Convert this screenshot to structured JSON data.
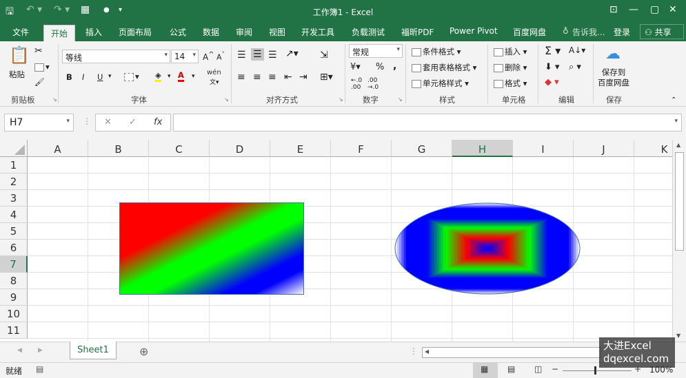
{
  "window": {
    "title": "工作簿1 - Excel"
  },
  "tabs": [
    "文件",
    "开始",
    "插入",
    "页面布局",
    "公式",
    "数据",
    "审阅",
    "视图",
    "开发工具",
    "负载测试",
    "福昕PDF",
    "Power Pivot",
    "百度网盘"
  ],
  "tell_me": "告诉我...",
  "login": "登录",
  "share": "共享",
  "ribbon": {
    "clipboard": {
      "paste": "粘贴",
      "label": "剪贴板"
    },
    "font": {
      "name": "等线",
      "size": "14",
      "label": "字体",
      "bold": "B",
      "italic": "I",
      "underline": "U",
      "wen": "wén"
    },
    "alignment": {
      "label": "对齐方式"
    },
    "number": {
      "format": "常规",
      "label": "数字",
      "percent": "%",
      "comma": ","
    },
    "styles": {
      "cond": "条件格式",
      "table": "套用表格格式",
      "cell": "单元格样式",
      "label": "样式"
    },
    "cells": {
      "insert": "插入",
      "delete": "删除",
      "format": "格式",
      "label": "单元格"
    },
    "editing": {
      "label": "编辑"
    },
    "save": {
      "btn": "保存到\n百度网盘",
      "label": "保存"
    }
  },
  "formula_bar": {
    "namebox": "H7",
    "fx": "fx",
    "value": ""
  },
  "columns": [
    "A",
    "B",
    "C",
    "D",
    "E",
    "F",
    "G",
    "H",
    "I",
    "J",
    "K"
  ],
  "rows": [
    "1",
    "2",
    "3",
    "4",
    "5",
    "6",
    "7",
    "8",
    "9",
    "10",
    "11"
  ],
  "selected_cell": {
    "col": "H",
    "row": "7"
  },
  "sheet": {
    "name": "Sheet1"
  },
  "status": {
    "ready": "就绪",
    "zoom": "100%"
  },
  "watermark": {
    "line1": "大进Excel",
    "line2": "dqexcel.com"
  },
  "colors": {
    "accent": "#217346"
  }
}
